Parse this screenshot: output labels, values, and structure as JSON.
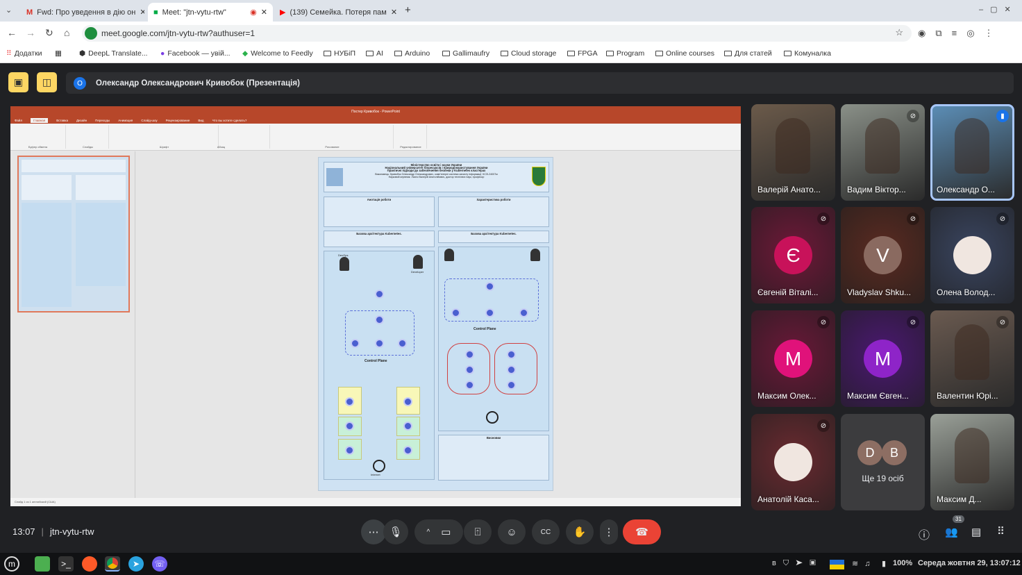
{
  "browser": {
    "tabs": [
      {
        "label": "Fwd: Про уведення в дію он",
        "icon": "gmail-icon",
        "active": false
      },
      {
        "label": "Meet: \"jtn-vytu-rtw\"",
        "icon": "meet-icon",
        "active": true,
        "recording": true
      },
      {
        "label": "(139) Семейка. Потеря пам",
        "icon": "youtube-icon",
        "active": false
      }
    ],
    "new_tab": "+",
    "url": "meet.google.com/jtn-vytu-rtw?authuser=1",
    "bookmarks": [
      {
        "label": "Додатки",
        "icon": "apps-icon"
      },
      {
        "label": "DeepL Translate...",
        "icon": "deepl-icon"
      },
      {
        "label": "Facebook — увій...",
        "icon": "facebook-icon"
      },
      {
        "label": "Welcome to Feedly",
        "icon": "feedly-icon"
      },
      {
        "label": "НУБіП",
        "icon": "folder-icon"
      },
      {
        "label": "AI",
        "icon": "folder-icon"
      },
      {
        "label": "Arduino",
        "icon": "folder-icon"
      },
      {
        "label": "Gallimaufry",
        "icon": "folder-icon"
      },
      {
        "label": "Cloud storage",
        "icon": "folder-icon"
      },
      {
        "label": "FPGA",
        "icon": "folder-icon"
      },
      {
        "label": "Program",
        "icon": "folder-icon"
      },
      {
        "label": "Online courses",
        "icon": "folder-icon"
      },
      {
        "label": "Для статей",
        "icon": "folder-icon"
      },
      {
        "label": "Комуналка",
        "icon": "folder-icon"
      }
    ]
  },
  "meet": {
    "presenter_initial": "О",
    "presenter_banner": "Олександр Олександрович Кривобок (Презентація)",
    "meeting_time": "13:07",
    "meeting_code": "jtn-vytu-rtw",
    "participants_count": "31",
    "more_people": "Ще 19 осіб",
    "more_initials": [
      "D",
      "B"
    ],
    "accent_end_call": "#ea4335",
    "tiles": [
      {
        "name": "Валерій Анато...",
        "type": "video",
        "bg": "#6b5a4a"
      },
      {
        "name": "Вадим Віктор...",
        "type": "video",
        "bg": "#8a9088",
        "muted": true
      },
      {
        "name": "Олександр О...",
        "type": "video",
        "bg": "#5c8fb8",
        "speaking": true
      },
      {
        "name": "Євгеній Віталі...",
        "type": "avatar",
        "initial": "Є",
        "bg": "#6e1838",
        "avatar": "#c8125a",
        "muted": true
      },
      {
        "name": "Vladyslav Shku...",
        "type": "avatar",
        "initial": "V",
        "bg": "#5a2a20",
        "avatar": "#8a6a60",
        "muted": true
      },
      {
        "name": "Олена Волод...",
        "type": "photo",
        "bg": "#3a4560",
        "muted": true
      },
      {
        "name": "Максим Олек...",
        "type": "avatar",
        "initial": "М",
        "bg": "#6a1838",
        "avatar": "#e0127a",
        "muted": true
      },
      {
        "name": "Максим Євген...",
        "type": "avatar",
        "initial": "М",
        "bg": "#4a1870",
        "avatar": "#8e24c8",
        "muted": true
      },
      {
        "name": "Валентин Юрі...",
        "type": "video",
        "bg": "#6a5a50",
        "muted": true
      },
      {
        "name": "Анатолій Каса...",
        "type": "photo",
        "bg": "#6a2a30",
        "muted": true
      },
      {
        "name": "Максим Д...",
        "type": "video",
        "bg": "#9aa098"
      }
    ]
  },
  "ppt": {
    "window_title": "Постер Кривобок - PowerPoint",
    "tabs": [
      "Файл",
      "Главная",
      "Вставка",
      "Дизайн",
      "Переходы",
      "Анимация",
      "Слайд-шоу",
      "Рецензирование",
      "Вид",
      "Что вы хотите сделать?"
    ],
    "groups": [
      "Буфер обмена",
      "Слайды",
      "Шрифт",
      "Абзац",
      "Рисование",
      "Редактирование"
    ],
    "status": "Слайд 1 из 1   английский (США)",
    "poster": {
      "header": [
        "Міністерство освіти і науки України",
        "Національний університет біоресурсів і природокористування України",
        "Практичні підходи до забезпечення безпеки у Kubernetes кластерах",
        "Виконавець: Кривобок Олександр Олександрович, комп'ютерні системи захисту інформації, КСЗІ-24007м",
        "Науковий керівник: Лахно Валерій Анатолійович, доктор технічних наук, професор"
      ],
      "annotation_title": "Анотація роботи",
      "characteristics_title": "Характеристика роботи",
      "arch1_title": "Базова архітектура Kubernetes.",
      "arch2_title": "Базова архітектура Kubernetes.",
      "control_plane": "Control Plane",
      "conclusions_title": "Висновки",
      "devops": "DevOps",
      "developer": "Developer",
      "internet": "Internet"
    }
  },
  "taskbar": {
    "battery": "100%",
    "datetime": "Середа жовтня 29, 13:07:12"
  }
}
